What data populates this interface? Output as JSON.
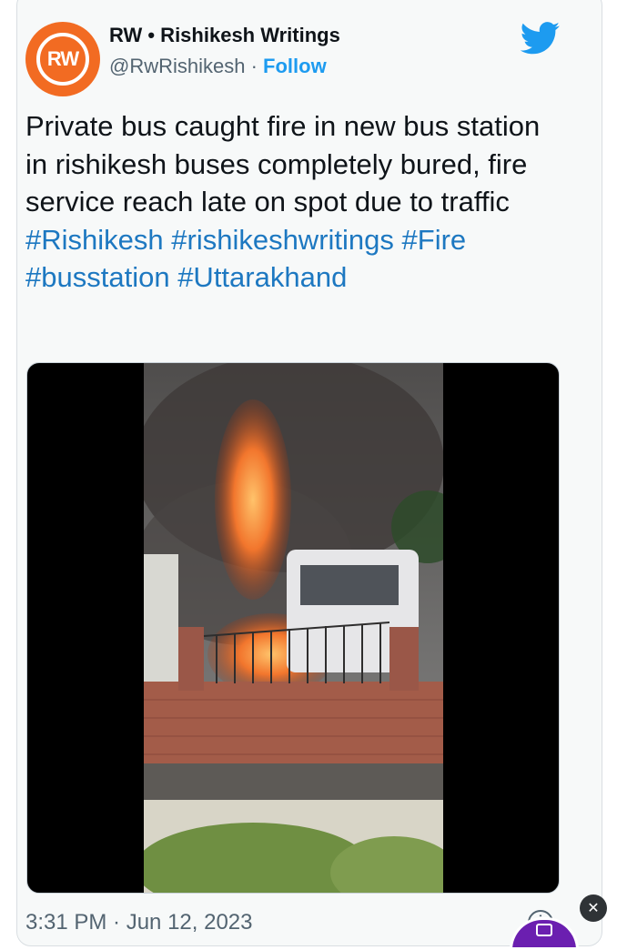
{
  "author": {
    "avatar_text": "RW",
    "display_name": "RW • Rishikesh Writings",
    "handle": "@RwRishikesh",
    "separator": " · ",
    "follow_label": "Follow"
  },
  "tweet": {
    "text_plain": "Private bus caught fire in new bus station in rishikesh buses completely bured, fire service reach late on spot due to traffic ",
    "hashtags": [
      "#Rishikesh",
      "#rishikeshwritings",
      "#Fire",
      "#busstation",
      "#Uttarakhand"
    ],
    "timestamp": "3:31 PM · Jun 12, 2023"
  },
  "media": {
    "kind": "video",
    "description_icon": "video-thumbnail"
  },
  "icons": {
    "bird": "twitter-bird-icon",
    "info": "info-icon",
    "close": "close-icon"
  },
  "colors": {
    "accent": "#1d9bf0",
    "hashtag": "#1d78c1",
    "avatar": "#f26b22",
    "widget": "#6b1fb0"
  }
}
